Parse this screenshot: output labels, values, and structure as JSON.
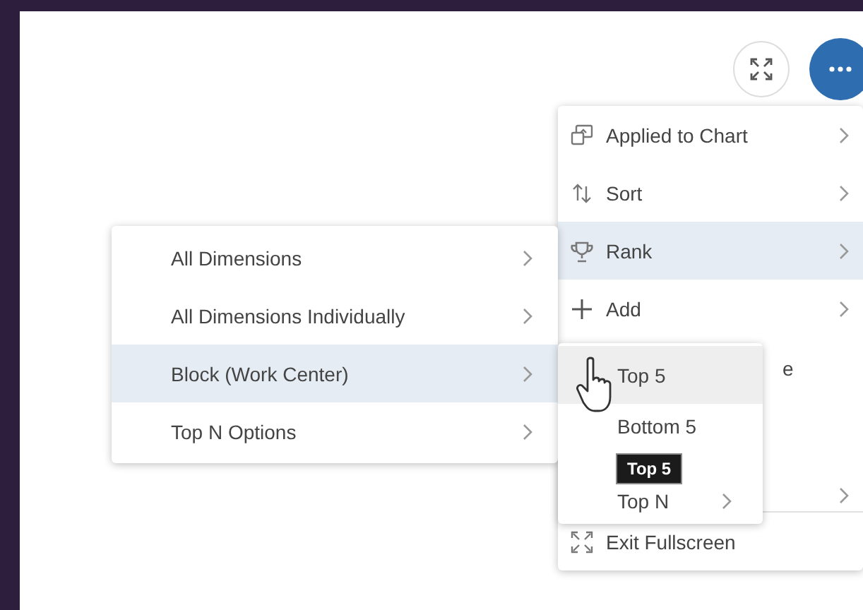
{
  "toolbar": {
    "buttons": [
      {
        "kind": "exit-fullscreen"
      },
      {
        "kind": "more",
        "selected": true
      }
    ]
  },
  "menu": {
    "items": [
      {
        "kind": "item",
        "label": "Applied to Chart",
        "chevron": true,
        "selected": false
      },
      {
        "kind": "item",
        "label": "Sort",
        "chevron": true,
        "selected": false
      },
      {
        "kind": "item",
        "label": "Rank",
        "chevron": true,
        "selected": true
      },
      {
        "kind": "item",
        "label": "Add",
        "chevron": true,
        "selected": false
      },
      {
        "kind": "covered",
        "label": "e",
        "chevron": false
      },
      {
        "kind": "covered",
        "chevron": true
      },
      {
        "kind": "separator"
      },
      {
        "kind": "item",
        "label": "Exit Fullscreen",
        "chevron": false,
        "selected": false
      }
    ]
  },
  "dimension_menu": {
    "items": [
      {
        "label": "All Dimensions",
        "chevron": true,
        "selected": false
      },
      {
        "label": "All Dimensions Individually",
        "chevron": true,
        "selected": false
      },
      {
        "label": "Block (Work Center)",
        "chevron": true,
        "selected": true
      },
      {
        "label": "Top N Options",
        "chevron": true,
        "selected": false
      }
    ]
  },
  "rank_menu": {
    "items": [
      {
        "label": "Top 5",
        "chevron": false,
        "selected": true
      },
      {
        "label": "Bottom 5",
        "chevron": false,
        "selected": false
      },
      {
        "label": "Top N",
        "chevron": true,
        "selected": false
      }
    ]
  },
  "tooltip": {
    "text": "Top 5"
  }
}
